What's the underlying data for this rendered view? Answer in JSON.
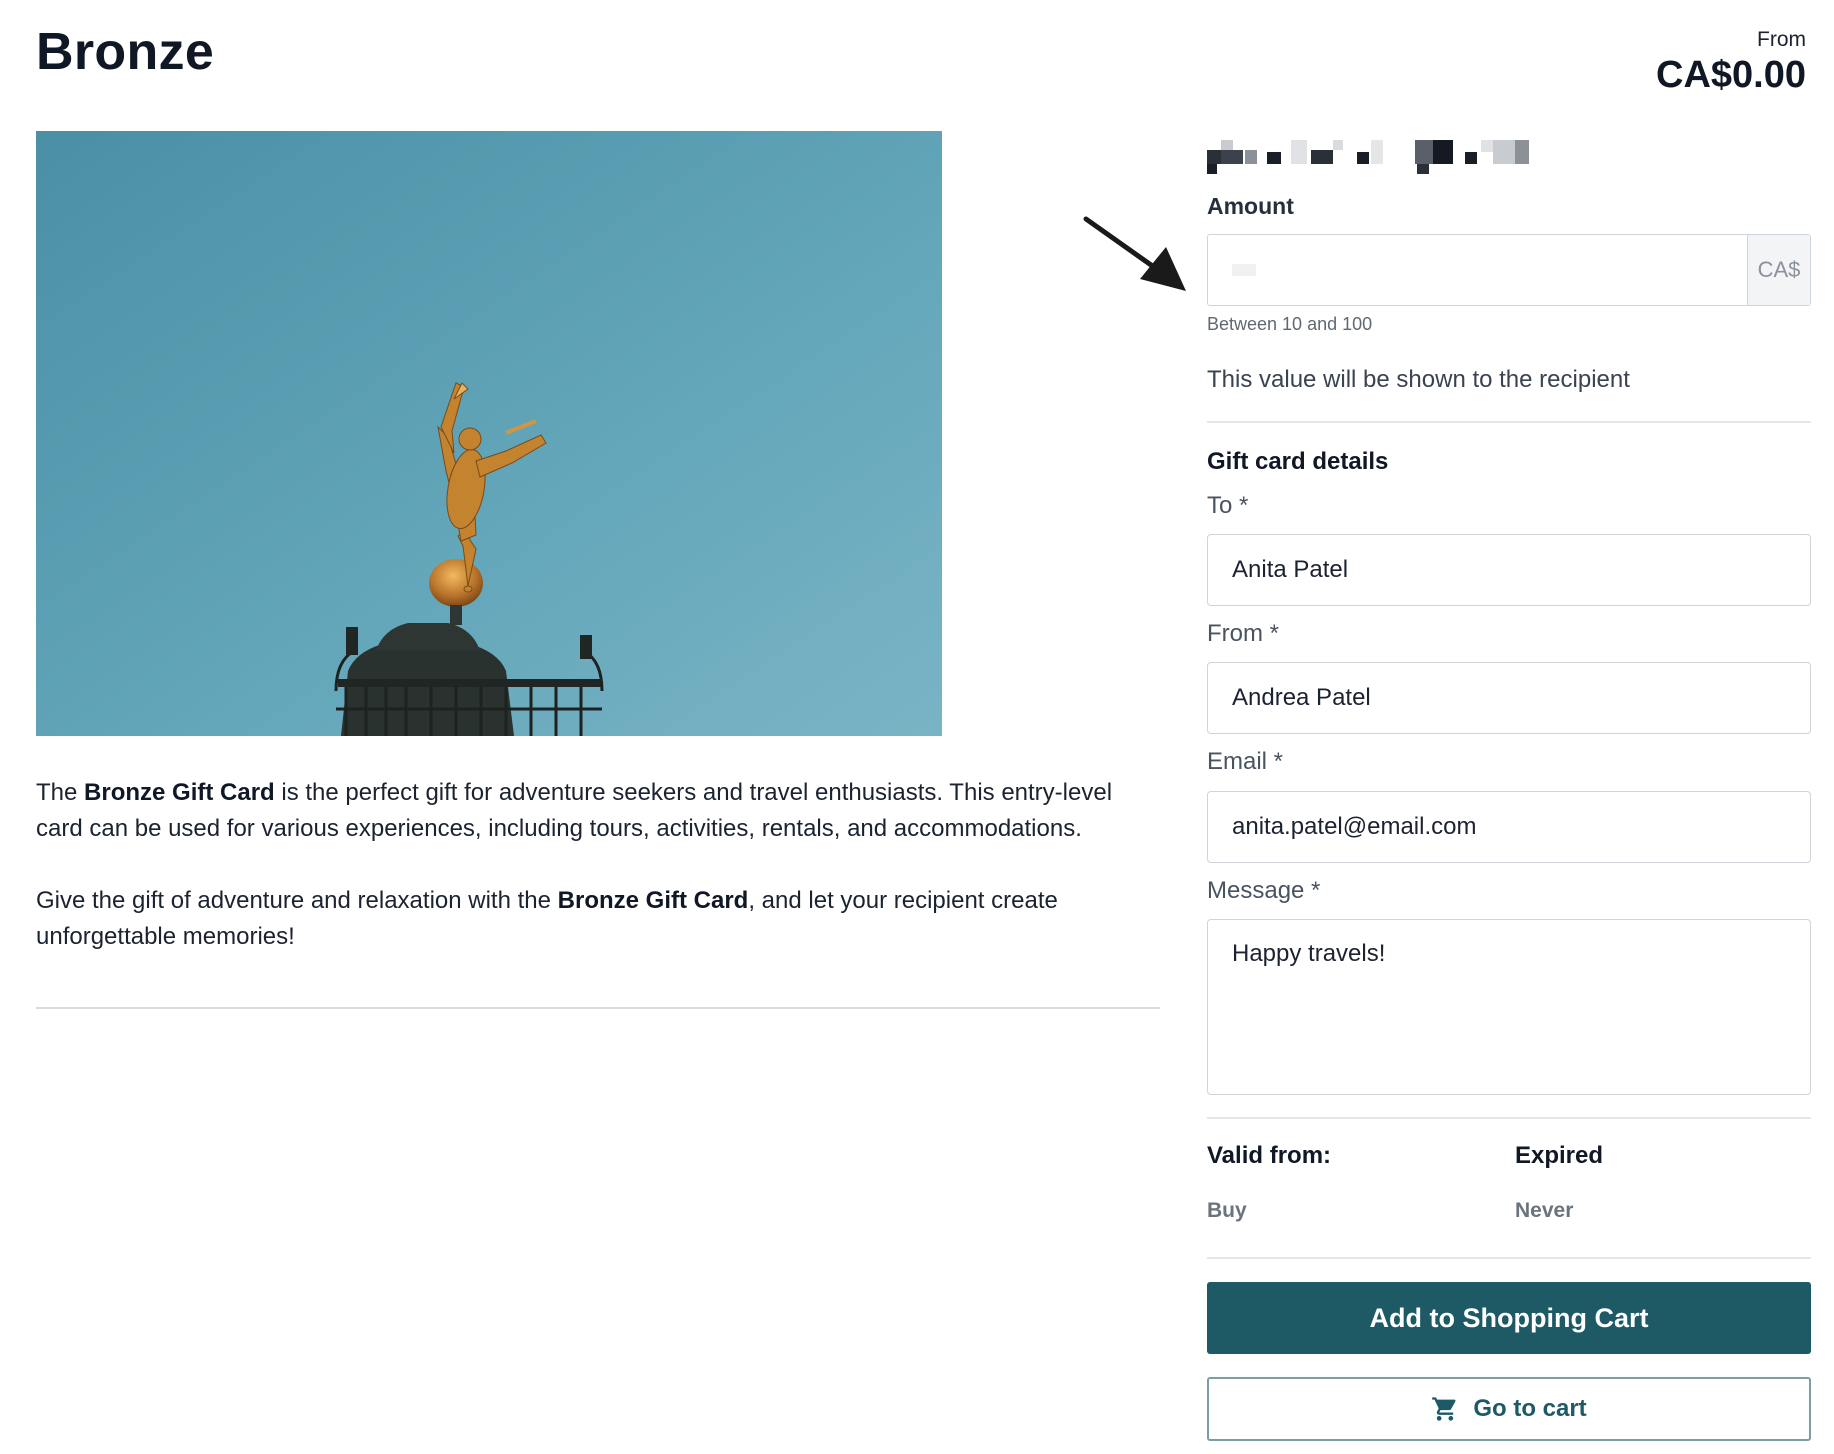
{
  "product": {
    "title": "Bronze",
    "price_prefix": "From",
    "price": "CA$0.00",
    "image_icon": "gilded-statue-photo"
  },
  "description": {
    "p1_pre": "The ",
    "p1_bold": "Bronze Gift Card",
    "p1_post": " is the perfect gift for adventure seekers and travel enthusiasts. This entry-level card can be used for various experiences, including tours, activities, rentals, and accommodations.",
    "p2_pre": "Give the gift of adventure and relaxation with the ",
    "p2_bold": "Bronze Gift Card",
    "p2_post": ", and let your recipient create unforgettable memories!"
  },
  "amount": {
    "label": "Amount",
    "value": "",
    "currency_suffix": "CA$",
    "hint": "Between 10 and 100",
    "recipient_note": "This value will be shown to the recipient"
  },
  "gift_card": {
    "section_title": "Gift card details",
    "to_label": "To *",
    "to_value": "Anita Patel",
    "from_label": "From *",
    "from_value": "Andrea Patel",
    "email_label": "Email *",
    "email_value": "anita.patel@email.com",
    "message_label": "Message *",
    "message_value": "Happy travels!"
  },
  "validity": {
    "valid_from_label": "Valid from:",
    "valid_from_value": "Buy",
    "expired_label": "Expired",
    "expired_value": "Never"
  },
  "actions": {
    "add_to_cart": "Add to Shopping Cart",
    "go_to_cart": "Go to cart",
    "go_to_cart_icon": "shopping-cart-icon"
  },
  "colors": {
    "primary": "#1d5a66",
    "sky": "#5a9fb4"
  }
}
